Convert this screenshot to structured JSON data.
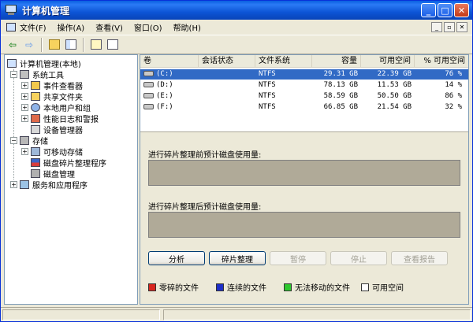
{
  "window": {
    "title": "计算机管理",
    "icon": "computer-management-icon"
  },
  "menubar": {
    "items": [
      {
        "label": "文件(F)"
      },
      {
        "label": "操作(A)"
      },
      {
        "label": "查看(V)"
      },
      {
        "label": "窗口(O)"
      },
      {
        "label": "帮助(H)"
      }
    ]
  },
  "tree": {
    "root": "计算机管理(本地)",
    "system_tools": "系统工具",
    "event_viewer": "事件查看器",
    "shared_folders": "共享文件夹",
    "local_users": "本地用户和组",
    "perf_logs": "性能日志和警报",
    "device_manager": "设备管理器",
    "storage": "存储",
    "removable_storage": "可移动存储",
    "defragmenter": "磁盘碎片整理程序",
    "disk_management": "磁盘管理",
    "services": "服务和应用程序"
  },
  "volumes": {
    "headers": [
      "卷",
      "会话状态",
      "文件系统",
      "容量",
      "可用空间",
      "% 可用空间"
    ],
    "rows": [
      {
        "volume": "(C:)",
        "fs": "NTFS",
        "capacity": "29.31 GB",
        "free": "22.39 GB",
        "pct": "76 %"
      },
      {
        "volume": "(D:)",
        "fs": "NTFS",
        "capacity": "78.13 GB",
        "free": "11.53 GB",
        "pct": "14 %"
      },
      {
        "volume": "(E:)",
        "fs": "NTFS",
        "capacity": "58.59 GB",
        "free": "50.50 GB",
        "pct": "86 %"
      },
      {
        "volume": "(F:)",
        "fs": "NTFS",
        "capacity": "66.85 GB",
        "free": "21.54 GB",
        "pct": "32 %"
      }
    ]
  },
  "analysis": {
    "before_label": "进行碎片整理前预计磁盘使用量:",
    "after_label": "进行碎片整理后预计磁盘使用量:"
  },
  "buttons": {
    "analyze": "分析",
    "defragment": "碎片整理",
    "pause": "暂停",
    "stop": "停止",
    "view_report": "查看报告"
  },
  "legend": [
    {
      "label": "零碎的文件",
      "color": "#d8261e"
    },
    {
      "label": "连续的文件",
      "color": "#1e2fc8"
    },
    {
      "label": "无法移动的文件",
      "color": "#2ec82e"
    },
    {
      "label": "可用空间",
      "color": "#ffffff"
    }
  ],
  "colors": {
    "titlebar": "#0a5fe0",
    "selection": "#316ac5"
  }
}
